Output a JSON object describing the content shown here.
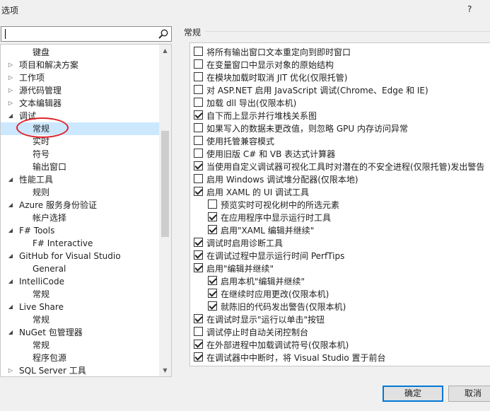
{
  "window": {
    "title": "选项",
    "help": "?"
  },
  "search": {
    "value": "",
    "placeholder": ""
  },
  "tree": {
    "items": [
      {
        "label": "键盘",
        "level": 1,
        "arrow": ""
      },
      {
        "label": "项目和解决方案",
        "level": 0,
        "arrow": "collapsed"
      },
      {
        "label": "工作项",
        "level": 0,
        "arrow": "collapsed"
      },
      {
        "label": "源代码管理",
        "level": 0,
        "arrow": "collapsed"
      },
      {
        "label": "文本编辑器",
        "level": 0,
        "arrow": "collapsed"
      },
      {
        "label": "调试",
        "level": 0,
        "arrow": "expanded"
      },
      {
        "label": "常规",
        "level": 1,
        "arrow": "",
        "selected": true
      },
      {
        "label": "实时",
        "level": 1,
        "arrow": ""
      },
      {
        "label": "符号",
        "level": 1,
        "arrow": ""
      },
      {
        "label": "输出窗口",
        "level": 1,
        "arrow": ""
      },
      {
        "label": "性能工具",
        "level": 0,
        "arrow": "expanded"
      },
      {
        "label": "规则",
        "level": 1,
        "arrow": ""
      },
      {
        "label": "Azure 服务身份验证",
        "level": 0,
        "arrow": "expanded"
      },
      {
        "label": "帐户选择",
        "level": 1,
        "arrow": ""
      },
      {
        "label": "F# Tools",
        "level": 0,
        "arrow": "expanded"
      },
      {
        "label": "F# Interactive",
        "level": 1,
        "arrow": ""
      },
      {
        "label": "GitHub for Visual Studio",
        "level": 0,
        "arrow": "expanded"
      },
      {
        "label": "General",
        "level": 1,
        "arrow": ""
      },
      {
        "label": "IntelliCode",
        "level": 0,
        "arrow": "expanded"
      },
      {
        "label": "常规",
        "level": 1,
        "arrow": ""
      },
      {
        "label": "Live Share",
        "level": 0,
        "arrow": "expanded"
      },
      {
        "label": "常规",
        "level": 1,
        "arrow": ""
      },
      {
        "label": "NuGet 包管理器",
        "level": 0,
        "arrow": "expanded"
      },
      {
        "label": "常规",
        "level": 1,
        "arrow": ""
      },
      {
        "label": "程序包源",
        "level": 1,
        "arrow": ""
      },
      {
        "label": "SQL Server 工具",
        "level": 0,
        "arrow": "collapsed"
      }
    ],
    "scroll_up_icon": "scroll-up-arrow",
    "scroll_down_icon": "scroll-down-arrow"
  },
  "panel": {
    "title": "常规",
    "options": [
      {
        "label": "将所有输出窗口文本重定向到即时窗口",
        "checked": false,
        "indent": 0
      },
      {
        "label": "在变量窗口中显示对象的原始结构",
        "checked": false,
        "indent": 0
      },
      {
        "label": "在模块加载时取消 JIT 优化(仅限托管)",
        "checked": false,
        "indent": 0
      },
      {
        "label": "对 ASP.NET 启用 JavaScript 调试(Chrome、Edge 和 IE)",
        "checked": false,
        "indent": 0
      },
      {
        "label": "加载 dll 导出(仅限本机)",
        "checked": false,
        "indent": 0
      },
      {
        "label": "自下而上显示并行堆栈关系图",
        "checked": true,
        "indent": 0
      },
      {
        "label": "如果写入的数据未更改值，则忽略 GPU 内存访问异常",
        "checked": false,
        "indent": 0
      },
      {
        "label": "使用托管兼容模式",
        "checked": false,
        "indent": 0
      },
      {
        "label": "使用旧版 C# 和 VB 表达式计算器",
        "checked": false,
        "indent": 0
      },
      {
        "label": "当使用自定义调试器可视化工具时对潜在的不安全进程(仅限托管)发出警告",
        "checked": true,
        "indent": 0
      },
      {
        "label": "启用 Windows 调试堆分配器(仅限本地)",
        "checked": false,
        "indent": 0
      },
      {
        "label": "启用 XAML 的 UI 调试工具",
        "checked": true,
        "indent": 0
      },
      {
        "label": "预览实时可视化树中的所选元素",
        "checked": false,
        "indent": 1
      },
      {
        "label": "在应用程序中显示运行时工具",
        "checked": true,
        "indent": 1
      },
      {
        "label": "启用\"XAML 编辑并继续\"",
        "checked": true,
        "indent": 1
      },
      {
        "label": "调试时启用诊断工具",
        "checked": true,
        "indent": 0
      },
      {
        "label": "在调试过程中显示运行时间 PerfTips",
        "checked": true,
        "indent": 0
      },
      {
        "label": "启用\"编辑并继续\"",
        "checked": true,
        "indent": 0
      },
      {
        "label": "启用本机\"编辑并继续\"",
        "checked": true,
        "indent": 1
      },
      {
        "label": "在继续时应用更改(仅限本机)",
        "checked": true,
        "indent": 1
      },
      {
        "label": "就陈旧的代码发出警告(仅限本机)",
        "checked": true,
        "indent": 1
      },
      {
        "label": "在调试时显示\"运行以单击\"按钮",
        "checked": true,
        "indent": 0
      },
      {
        "label": "调试停止时自动关闭控制台",
        "checked": false,
        "indent": 0
      },
      {
        "label": "在外部进程中加载调试符号(仅限本机)",
        "checked": true,
        "indent": 0
      },
      {
        "label": "在调试器中中断时，将 Visual Studio 置于前台",
        "checked": true,
        "indent": 0
      }
    ]
  },
  "buttons": {
    "ok": "确定",
    "cancel": "取消"
  },
  "colors": {
    "selection": "#cce8ff",
    "highlight_ring": "#e0222a",
    "primary_border": "#0078d7"
  }
}
